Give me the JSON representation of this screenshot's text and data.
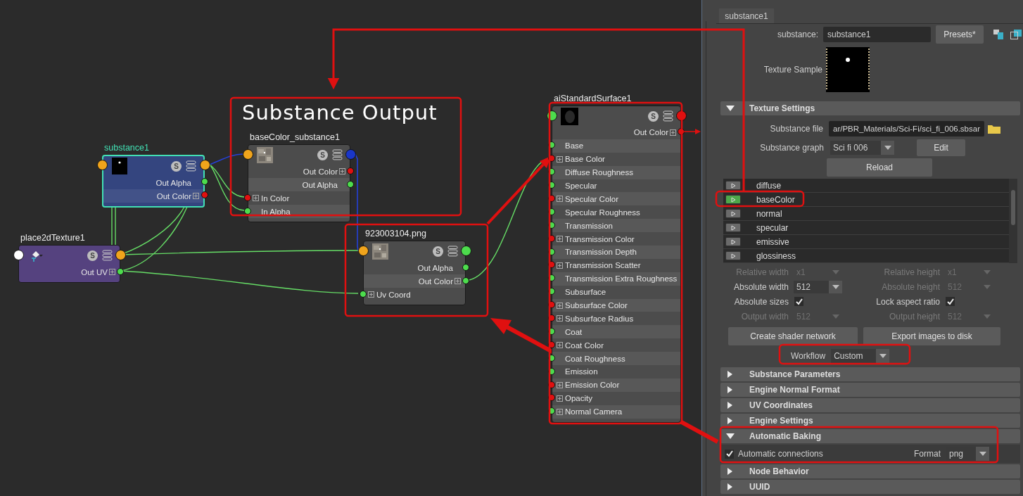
{
  "graph": {
    "annotation": {
      "title": "Substance Output"
    },
    "nodes": [
      {
        "title": "substance1",
        "color": "#34457f",
        "selected": true,
        "thumbnail": {
          "kind": "mask"
        },
        "badge": "S",
        "in_port": {
          "color": "#f0a41c"
        },
        "out_port": {
          "color": "#f0a41c"
        },
        "ports": [
          {
            "label": "Out Alpha",
            "kind": "out",
            "color": "#4ddc4d",
            "compound": false
          },
          {
            "label": "Out Color",
            "kind": "out",
            "color": "#e01010",
            "compound": true
          }
        ]
      },
      {
        "title": "place2dTexture1",
        "color": "#55427f",
        "selected": false,
        "thumbnail": {
          "kind": "placement"
        },
        "badge": "S",
        "in_port": {
          "color": "#ffffff"
        },
        "out_port": {
          "color": "#f0a41c"
        },
        "ports": [
          {
            "label": "Out UV",
            "kind": "out",
            "color": "#4ddc4d",
            "compound": true
          }
        ]
      },
      {
        "title": "baseColor_substance1",
        "color": "#4c4c4c",
        "selected": false,
        "thumbnail": {
          "kind": "texture"
        },
        "badge": "S",
        "in_port": {
          "color": "#f0a41c"
        },
        "out_port": {
          "color": "#1a36c8"
        },
        "ports": [
          {
            "label": "Out Color",
            "kind": "out",
            "color": "#e01010",
            "compound": true
          },
          {
            "label": "Out Alpha",
            "kind": "out",
            "color": "#4ddc4d",
            "compound": false
          },
          {
            "label": "In Color",
            "kind": "in",
            "color": "#e01010",
            "compound": true
          },
          {
            "label": "In Alpha",
            "kind": "in",
            "color": "#4ddc4d",
            "compound": false
          }
        ]
      },
      {
        "title": "923003104.png",
        "color": "#4c4c4c",
        "selected": false,
        "thumbnail": {
          "kind": "texture"
        },
        "badge": "S",
        "in_port": {
          "color": "#f0a41c"
        },
        "out_port": {
          "color": "#4ddc4d"
        },
        "ports": [
          {
            "label": "Out Alpha",
            "kind": "out",
            "color": "#4ddc4d",
            "compound": false
          },
          {
            "label": "Out Color",
            "kind": "out",
            "color": "#4ddc4d",
            "compound": true
          },
          {
            "label": "Uv Coord",
            "kind": "in",
            "color": "#4ddc4d",
            "compound": true
          }
        ]
      },
      {
        "title": "aiStandardSurface1",
        "color": "#4c4c4c",
        "selected": false,
        "thumbnail": {
          "kind": "sphere"
        },
        "badge": "S",
        "in_port": {
          "color": "#4ddc4d"
        },
        "out_port": {
          "color": "#e01010"
        },
        "ports": [
          {
            "label": "Out Color",
            "kind": "out",
            "color": "#e01010",
            "compound": true
          },
          {
            "label": "Base",
            "kind": "in",
            "color": "#4ddc4d",
            "compound": false
          },
          {
            "label": "Base Color",
            "kind": "in",
            "color": "#e01010",
            "compound": true
          },
          {
            "label": "Diffuse Roughness",
            "kind": "in",
            "color": "#4ddc4d",
            "compound": false
          },
          {
            "label": "Specular",
            "kind": "in",
            "color": "#4ddc4d",
            "compound": false
          },
          {
            "label": "Specular Color",
            "kind": "in",
            "color": "#e01010",
            "compound": true
          },
          {
            "label": "Specular Roughness",
            "kind": "in",
            "color": "#4ddc4d",
            "compound": false
          },
          {
            "label": "Transmission",
            "kind": "in",
            "color": "#4ddc4d",
            "compound": false
          },
          {
            "label": "Transmission Color",
            "kind": "in",
            "color": "#e01010",
            "compound": true
          },
          {
            "label": "Transmission Depth",
            "kind": "in",
            "color": "#4ddc4d",
            "compound": false
          },
          {
            "label": "Transmission Scatter",
            "kind": "in",
            "color": "#e01010",
            "compound": true
          },
          {
            "label": "Transmission Extra Roughness",
            "kind": "in",
            "color": "#4ddc4d",
            "compound": false
          },
          {
            "label": "Subsurface",
            "kind": "in",
            "color": "#4ddc4d",
            "compound": false
          },
          {
            "label": "Subsurface Color",
            "kind": "in",
            "color": "#e01010",
            "compound": true
          },
          {
            "label": "Subsurface Radius",
            "kind": "in",
            "color": "#e01010",
            "compound": true
          },
          {
            "label": "Coat",
            "kind": "in",
            "color": "#4ddc4d",
            "compound": false
          },
          {
            "label": "Coat Color",
            "kind": "in",
            "color": "#e01010",
            "compound": true
          },
          {
            "label": "Coat Roughness",
            "kind": "in",
            "color": "#4ddc4d",
            "compound": false
          },
          {
            "label": "Emission",
            "kind": "in",
            "color": "#4ddc4d",
            "compound": false
          },
          {
            "label": "Emission Color",
            "kind": "in",
            "color": "#e01010",
            "compound": true
          },
          {
            "label": "Opacity",
            "kind": "in",
            "color": "#e01010",
            "compound": true
          },
          {
            "label": "Normal Camera",
            "kind": "in",
            "color": "#4ddc4d",
            "compound": true
          }
        ]
      }
    ]
  },
  "property_editor": {
    "tab": {
      "label": "substance1",
      "selected": true
    },
    "name_field": {
      "label": "substance:",
      "value": "substance1"
    },
    "presets_button": "Presets*",
    "texture_sample": {
      "label": "Texture Sample"
    },
    "texture_settings": {
      "title": "Texture Settings",
      "expanded": true,
      "file": {
        "label": "Substance file",
        "value": "ar/PBR_Materials/Sci-Fi/sci_fi_006.sbsar"
      },
      "graph": {
        "label": "Substance graph",
        "value": "Sci fi 006"
      },
      "edit_button": "Edit",
      "reload_button": "Reload",
      "outputs": [
        {
          "name": "diffuse",
          "enabled": false
        },
        {
          "name": "baseColor",
          "enabled": true
        },
        {
          "name": "normal",
          "enabled": false
        },
        {
          "name": "specular",
          "enabled": false
        },
        {
          "name": "emissive",
          "enabled": false
        },
        {
          "name": "glossiness",
          "enabled": false
        }
      ],
      "size_fields": [
        {
          "kind": "dropdown",
          "label": "Relative width",
          "value": "x1",
          "disabled": true
        },
        {
          "kind": "dropdown",
          "label": "Relative height",
          "value": "x1",
          "disabled": true
        },
        {
          "kind": "dropdown",
          "label": "Absolute width",
          "value": "512",
          "disabled": false
        },
        {
          "kind": "dropdown",
          "label": "Absolute height",
          "value": "512",
          "disabled": true
        },
        {
          "kind": "checkbox",
          "label": "Absolute sizes",
          "checked": true
        },
        {
          "kind": "checkbox",
          "label": "Lock aspect ratio",
          "checked": true
        },
        {
          "kind": "dropdown",
          "label": "Output width",
          "value": "512",
          "disabled": true
        },
        {
          "kind": "dropdown",
          "label": "Output height",
          "value": "512",
          "disabled": true
        }
      ],
      "action_buttons": [
        "Create shader network",
        "Export images to disk"
      ],
      "workflow": {
        "label": "Workflow",
        "value": "Custom"
      }
    },
    "sections": [
      {
        "title": "Substance Parameters",
        "expanded": false
      },
      {
        "title": "Engine Normal Format",
        "expanded": false
      },
      {
        "title": "UV Coordinates",
        "expanded": false
      },
      {
        "title": "Engine Settings",
        "expanded": false
      },
      {
        "title": "Automatic Baking",
        "expanded": true,
        "connections": {
          "label": "Automatic connections",
          "checked": true
        },
        "format": {
          "label": "Format",
          "value": "png"
        }
      },
      {
        "title": "Node Behavior",
        "expanded": false
      },
      {
        "title": "UUID",
        "expanded": false
      }
    ]
  }
}
